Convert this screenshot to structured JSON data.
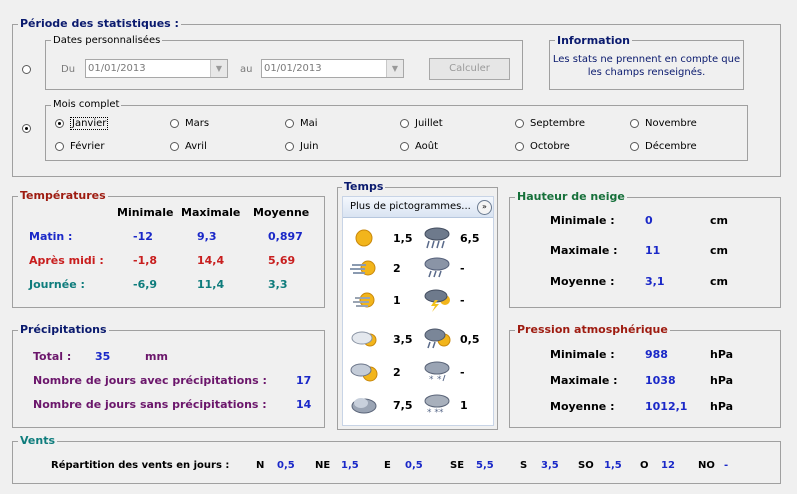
{
  "periode": {
    "title": "Période des statistiques :",
    "dates": {
      "legend": "Dates personnalisées",
      "du_label": "Du",
      "du_value": "01/01/2013",
      "au_label": "au",
      "au_value": "01/01/2013",
      "calculer": "Calculer"
    },
    "information": {
      "legend": "Information",
      "text_line1": "Les stats ne prennent en compte que",
      "text_line2": "les champs renseignés."
    },
    "mois": {
      "legend": "Mois complet",
      "months": [
        "Janvier",
        "Mars",
        "Mai",
        "Juillet",
        "Septembre",
        "Novembre",
        "Février",
        "Avril",
        "Juin",
        "Août",
        "Octobre",
        "Décembre"
      ],
      "selected": "Janvier"
    }
  },
  "temperatures": {
    "title": "Températures",
    "headers": [
      "Minimale",
      "Maximale",
      "Moyenne"
    ],
    "rows": [
      {
        "label": "Matin :",
        "min": "-12",
        "max": "9,3",
        "moy": "0,897"
      },
      {
        "label": "Après midi :",
        "min": "-1,8",
        "max": "14,4",
        "moy": "5,69"
      },
      {
        "label": "Journée :",
        "min": "-6,9",
        "max": "11,4",
        "moy": "3,3"
      }
    ]
  },
  "temps": {
    "title": "Temps",
    "dropdown": "Plus de pictogrammes...",
    "left_values": [
      "1,5",
      "2",
      "1",
      "3,5",
      "2",
      "7,5"
    ],
    "right_values": [
      "6,5",
      "-",
      "-",
      "0,5",
      "-",
      "1"
    ],
    "left_icons": [
      "sun-icon",
      "sun-wind-icon",
      "sun-haze-icon",
      "cloud-sun-icon",
      "cloud-sun-large-icon",
      "cloudy-icon"
    ],
    "right_icons": [
      "rain-heavy-icon",
      "rain-icon",
      "storm-icon",
      "rain-sun-icon",
      "snow-rain-icon",
      "snow-icon"
    ]
  },
  "neige": {
    "title": "Hauteur de neige",
    "rows": [
      {
        "label": "Minimale :",
        "value": "0",
        "unit": "cm"
      },
      {
        "label": "Maximale :",
        "value": "11",
        "unit": "cm"
      },
      {
        "label": "Moyenne :",
        "value": "3,1",
        "unit": "cm"
      }
    ]
  },
  "precipitations": {
    "title": "Précipitations",
    "total_label": "Total :",
    "total_value": "35",
    "total_unit": "mm",
    "avec_label": "Nombre de jours avec précipitations :",
    "avec_value": "17",
    "sans_label": "Nombre de jours sans précipitations :",
    "sans_value": "14"
  },
  "pression": {
    "title": "Pression atmosphérique",
    "rows": [
      {
        "label": "Minimale :",
        "value": "988",
        "unit": "hPa"
      },
      {
        "label": "Maximale :",
        "value": "1038",
        "unit": "hPa"
      },
      {
        "label": "Moyenne :",
        "value": "1012,1",
        "unit": "hPa"
      }
    ]
  },
  "vents": {
    "title": "Vents",
    "repartition_label": "Répartition des vents en jours :",
    "directions": [
      {
        "dir": "N",
        "value": "0,5"
      },
      {
        "dir": "NE",
        "value": "1,5"
      },
      {
        "dir": "E",
        "value": "0,5"
      },
      {
        "dir": "SE",
        "value": "5,5"
      },
      {
        "dir": "S",
        "value": "3,5"
      },
      {
        "dir": "SO",
        "value": "1,5"
      },
      {
        "dir": "O",
        "value": "12"
      },
      {
        "dir": "NO",
        "value": "-"
      }
    ]
  }
}
